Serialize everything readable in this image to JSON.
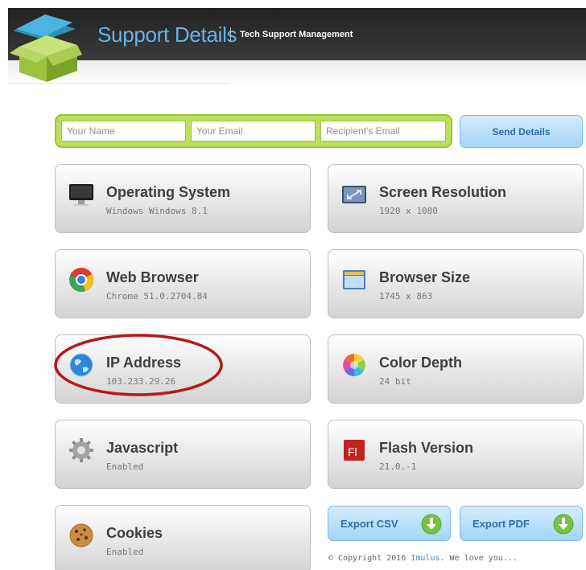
{
  "header": {
    "title": "Support Details",
    "subtitle": "Tech Support Management"
  },
  "form": {
    "name_placeholder": "Your Name",
    "email_placeholder": "Your Email",
    "recipient_placeholder": "Recipient's Email",
    "send_label": "Send Details"
  },
  "cards": {
    "os": {
      "title": "Operating System",
      "value": "Windows Windows 8.1",
      "icon": "monitor-icon"
    },
    "resolution": {
      "title": "Screen Resolution",
      "value": "1920 x 1080",
      "icon": "screen-resolution-icon"
    },
    "browser": {
      "title": "Web Browser",
      "value": "Chrome 51.0.2704.84",
      "icon": "chrome-icon"
    },
    "browser_size": {
      "title": "Browser Size",
      "value": "1745 x 863",
      "icon": "browser-window-icon"
    },
    "ip": {
      "title": "IP Address",
      "value": "103.233.29.26",
      "icon": "globe-icon"
    },
    "color_depth": {
      "title": "Color Depth",
      "value": "24 bit",
      "icon": "color-wheel-icon"
    },
    "javascript": {
      "title": "Javascript",
      "value": "Enabled",
      "icon": "gear-icon"
    },
    "flash": {
      "title": "Flash Version",
      "value": "21.0.-1",
      "icon": "flash-icon"
    },
    "cookies": {
      "title": "Cookies",
      "value": "Enabled",
      "icon": "cookie-icon"
    }
  },
  "export": {
    "csv_label": "Export CSV",
    "pdf_label": "Export PDF"
  },
  "footer": {
    "copyright_prefix": "© Copyright 2016 ",
    "copyright_link": "Imulus",
    "copyright_suffix": ". We love you..."
  },
  "colors": {
    "accent_blue": "#62b6e8",
    "form_green": "#bde05c",
    "annotation_red": "#b81818"
  }
}
